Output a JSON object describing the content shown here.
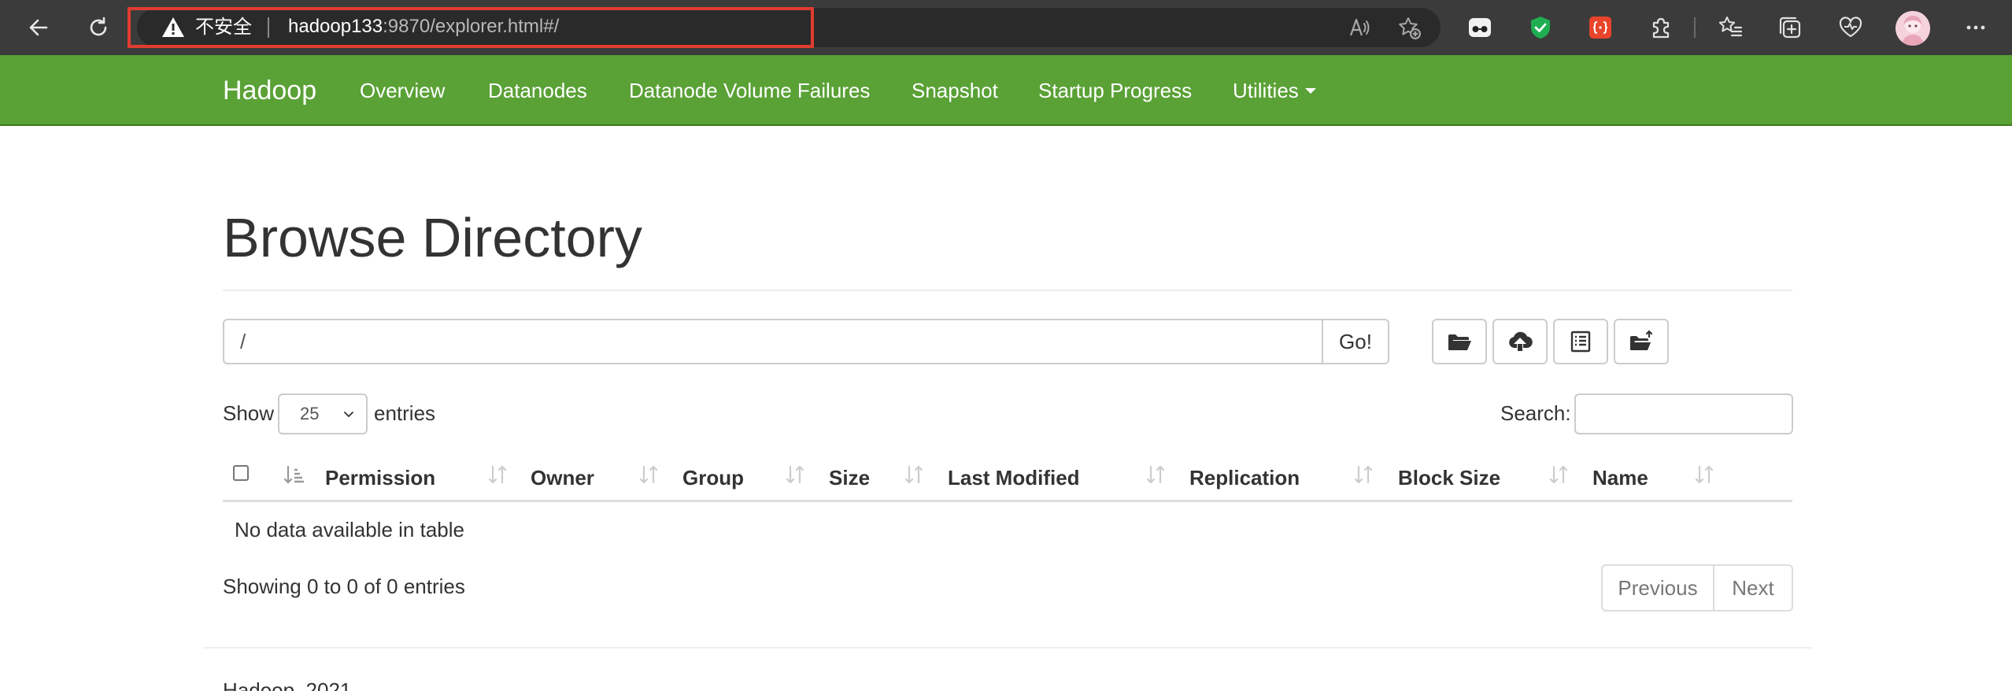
{
  "browser": {
    "security_label": "不安全",
    "url_host": "hadoop133",
    "url_rest": ":9870/explorer.html#/"
  },
  "navbar": {
    "brand": "Hadoop",
    "items": [
      {
        "label": "Overview"
      },
      {
        "label": "Datanodes"
      },
      {
        "label": "Datanode Volume Failures"
      },
      {
        "label": "Snapshot"
      },
      {
        "label": "Startup Progress"
      },
      {
        "label": "Utilities"
      }
    ]
  },
  "main": {
    "title": "Browse Directory",
    "path_value": "/",
    "go_label": "Go!",
    "show_label": "Show",
    "entries_value": "25",
    "entries_label": "entries",
    "search_label": "Search:",
    "search_value": "",
    "table": {
      "columns": [
        "Permission",
        "Owner",
        "Group",
        "Size",
        "Last Modified",
        "Replication",
        "Block Size",
        "Name"
      ],
      "rows": [],
      "empty_text": "No data available in table"
    },
    "info_text": "Showing 0 to 0 of 0 entries",
    "pagination": {
      "previous": "Previous",
      "next": "Next"
    },
    "footer": "Hadoop, 2021."
  },
  "colors": {
    "navbar_bg": "#5aa136",
    "chrome_bg": "#3b3b3b",
    "address_highlight": "#e03c31"
  },
  "icons": {
    "toolbar": [
      "folder-open-icon",
      "cloud-upload-icon",
      "list-icon",
      "move-folder-icon"
    ]
  }
}
